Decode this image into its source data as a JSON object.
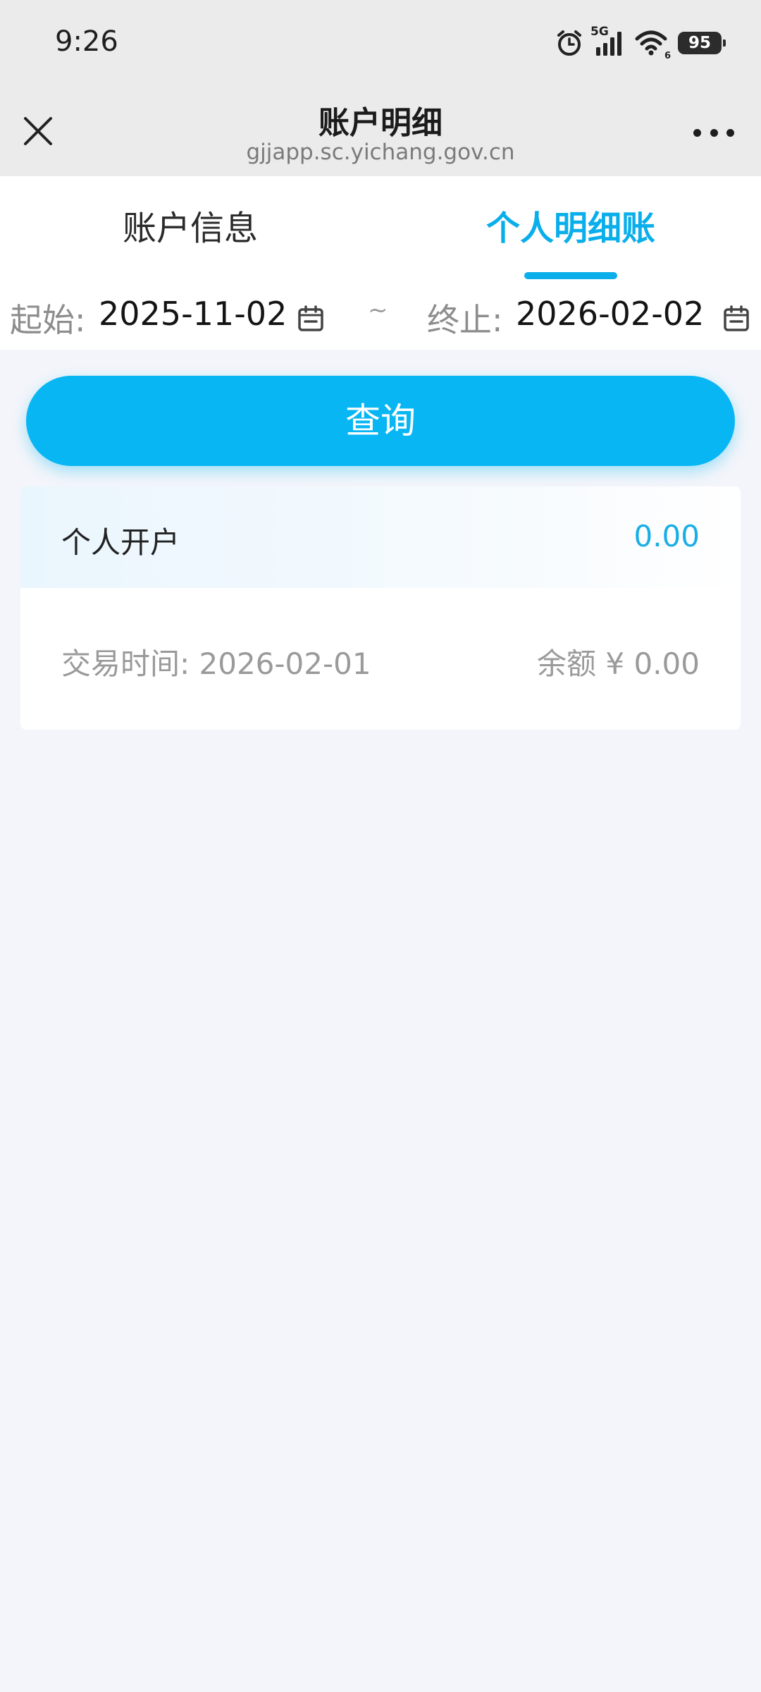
{
  "status_bar": {
    "time": "9:26",
    "network": "5G",
    "wifi_sub": "6",
    "battery": "95",
    "icons": [
      "alarm-icon",
      "signal-icon",
      "wifi-icon",
      "battery-icon"
    ]
  },
  "nav": {
    "title": "账户明细",
    "subtitle": "gjjapp.sc.yichang.gov.cn",
    "close_icon": "close-icon",
    "more_icon": "more-icon"
  },
  "tabs": [
    {
      "label": "账户信息",
      "active": false
    },
    {
      "label": "个人明细账",
      "active": true
    }
  ],
  "date_range": {
    "start_label": "起始:",
    "start_value": "2025-11-02",
    "separator": "~",
    "end_label": "终止:",
    "end_value": "2026-02-02",
    "icon": "calendar-icon"
  },
  "query_button": {
    "label": "查询"
  },
  "records": [
    {
      "type": "个人开户",
      "amount": "0.00",
      "time_label": "交易时间: 2026-02-01",
      "balance_label": "余额 ¥ 0.00"
    }
  ],
  "colors": {
    "accent": "#08b6f4",
    "page_bg": "#f3f5fa",
    "header_bg": "#ebebeb"
  }
}
